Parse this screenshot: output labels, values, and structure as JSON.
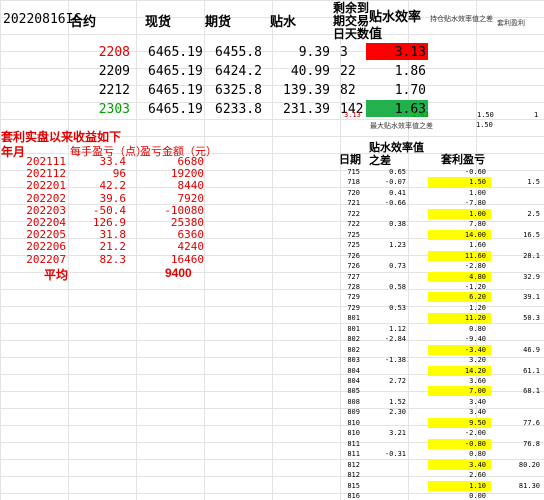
{
  "top": {
    "code": "20220816IC",
    "headers": [
      "合约",
      "现货",
      "期货",
      "贴水",
      "剩余到期交易日天数",
      "贴水效率值",
      "持仓贴水效率值之差",
      "套利盈利"
    ],
    "rows": [
      {
        "contract": "2208",
        "spot": "6465.19",
        "futures": "6455.8",
        "disc": "9.39",
        "days": "3",
        "eff": "3.13",
        "contract_color": "#e00000",
        "eff_bg": "#ff0000"
      },
      {
        "contract": "2209",
        "spot": "6465.19",
        "futures": "6424.2",
        "disc": "40.99",
        "days": "22",
        "eff": "1.86",
        "contract_color": "#000000",
        "eff_bg": ""
      },
      {
        "contract": "2212",
        "spot": "6465.19",
        "futures": "6325.8",
        "disc": "139.39",
        "days": "82",
        "eff": "1.70",
        "contract_color": "#000000",
        "eff_bg": ""
      },
      {
        "contract": "2303",
        "spot": "6465.19",
        "futures": "6233.8",
        "disc": "231.39",
        "days": "142",
        "eff": "1.63",
        "contract_color": "#00a000",
        "eff_bg": "#22b14c"
      }
    ],
    "small_row": {
      "a": "3.13",
      "b": "1.63",
      "c": "1.50",
      "d": "1"
    },
    "max_label": "最大贴水效率值之差",
    "max_value": "1.50"
  },
  "summary": {
    "title": "套利实盘以来收益如下",
    "headers": [
      "年月",
      "每手盈亏（点）",
      "盈亏金额（元）"
    ],
    "rows": [
      {
        "ym": "202111",
        "pts": "33.4",
        "amt": "6680"
      },
      {
        "ym": "202112",
        "pts": "96",
        "amt": "19200"
      },
      {
        "ym": "202201",
        "pts": "42.2",
        "amt": "8440"
      },
      {
        "ym": "202202",
        "pts": "39.6",
        "amt": "7920"
      },
      {
        "ym": "202203",
        "pts": "-50.4",
        "amt": "-10080"
      },
      {
        "ym": "202204",
        "pts": "126.9",
        "amt": "25380"
      },
      {
        "ym": "202205",
        "pts": "31.8",
        "amt": "6360"
      },
      {
        "ym": "202206",
        "pts": "21.2",
        "amt": "4240"
      },
      {
        "ym": "202207",
        "pts": "82.3",
        "amt": "16460"
      }
    ],
    "avg_label": "平均",
    "avg_value": "9400"
  },
  "daily": {
    "headers": [
      "日期",
      "贴水效率值之差",
      "套利盈亏"
    ],
    "rows": [
      {
        "d": "715",
        "diff": "0.65",
        "pnl": "-0.60",
        "hl": false,
        "cum": ""
      },
      {
        "d": "718",
        "diff": "-0.07",
        "pnl": "1.50",
        "hl": true,
        "cum": "1.5"
      },
      {
        "d": "720",
        "diff": "0.41",
        "pnl": "1.00",
        "hl": false,
        "cum": ""
      },
      {
        "d": "721",
        "diff": "-0.66",
        "pnl": "-7.80",
        "hl": false,
        "cum": ""
      },
      {
        "d": "722",
        "diff": "",
        "pnl": "1.00",
        "hl": true,
        "cum": "2.5"
      },
      {
        "d": "722",
        "diff": "0.38",
        "pnl": "7.80",
        "hl": false,
        "cum": ""
      },
      {
        "d": "725",
        "diff": "",
        "pnl": "14.00",
        "hl": true,
        "cum": "16.5"
      },
      {
        "d": "725",
        "diff": "1.23",
        "pnl": "1.60",
        "hl": false,
        "cum": ""
      },
      {
        "d": "726",
        "diff": "",
        "pnl": "11.60",
        "hl": true,
        "cum": "28.1"
      },
      {
        "d": "726",
        "diff": "0.73",
        "pnl": "-2.80",
        "hl": false,
        "cum": ""
      },
      {
        "d": "727",
        "diff": "",
        "pnl": "4.80",
        "hl": true,
        "cum": "32.9"
      },
      {
        "d": "728",
        "diff": "0.58",
        "pnl": "-1.20",
        "hl": false,
        "cum": ""
      },
      {
        "d": "729",
        "diff": "",
        "pnl": "6.20",
        "hl": true,
        "cum": "39.1"
      },
      {
        "d": "729",
        "diff": "0.53",
        "pnl": "1.20",
        "hl": false,
        "cum": ""
      },
      {
        "d": "801",
        "diff": "",
        "pnl": "11.20",
        "hl": true,
        "cum": "50.3"
      },
      {
        "d": "801",
        "diff": "1.12",
        "pnl": "0.80",
        "hl": false,
        "cum": ""
      },
      {
        "d": "802",
        "diff": "-2.84",
        "pnl": "-9.40",
        "hl": false,
        "cum": ""
      },
      {
        "d": "802",
        "diff": "",
        "pnl": "-3.40",
        "hl": true,
        "cum": "46.9"
      },
      {
        "d": "803",
        "diff": "-1.38",
        "pnl": "3.20",
        "hl": false,
        "cum": ""
      },
      {
        "d": "804",
        "diff": "",
        "pnl": "14.20",
        "hl": true,
        "cum": "61.1"
      },
      {
        "d": "804",
        "diff": "2.72",
        "pnl": "3.60",
        "hl": false,
        "cum": ""
      },
      {
        "d": "805",
        "diff": "",
        "pnl": "7.00",
        "hl": true,
        "cum": "68.1"
      },
      {
        "d": "808",
        "diff": "1.52",
        "pnl": "3.40",
        "hl": false,
        "cum": ""
      },
      {
        "d": "809",
        "diff": "2.30",
        "pnl": "3.40",
        "hl": false,
        "cum": ""
      },
      {
        "d": "810",
        "diff": "",
        "pnl": "9.50",
        "hl": true,
        "cum": "77.6"
      },
      {
        "d": "810",
        "diff": "3.21",
        "pnl": "-2.00",
        "hl": false,
        "cum": ""
      },
      {
        "d": "811",
        "diff": "",
        "pnl": "-0.80",
        "hl": true,
        "cum": "76.8"
      },
      {
        "d": "811",
        "diff": "-0.31",
        "pnl": "0.80",
        "hl": false,
        "cum": ""
      },
      {
        "d": "812",
        "diff": "",
        "pnl": "3.40",
        "hl": true,
        "cum": "80.20"
      },
      {
        "d": "812",
        "diff": "",
        "pnl": "2.60",
        "hl": false,
        "cum": ""
      },
      {
        "d": "815",
        "diff": "",
        "pnl": "1.10",
        "hl": true,
        "cum": "81.30"
      },
      {
        "d": "816",
        "diff": "",
        "pnl": "0.00",
        "hl": false,
        "cum": ""
      }
    ]
  }
}
